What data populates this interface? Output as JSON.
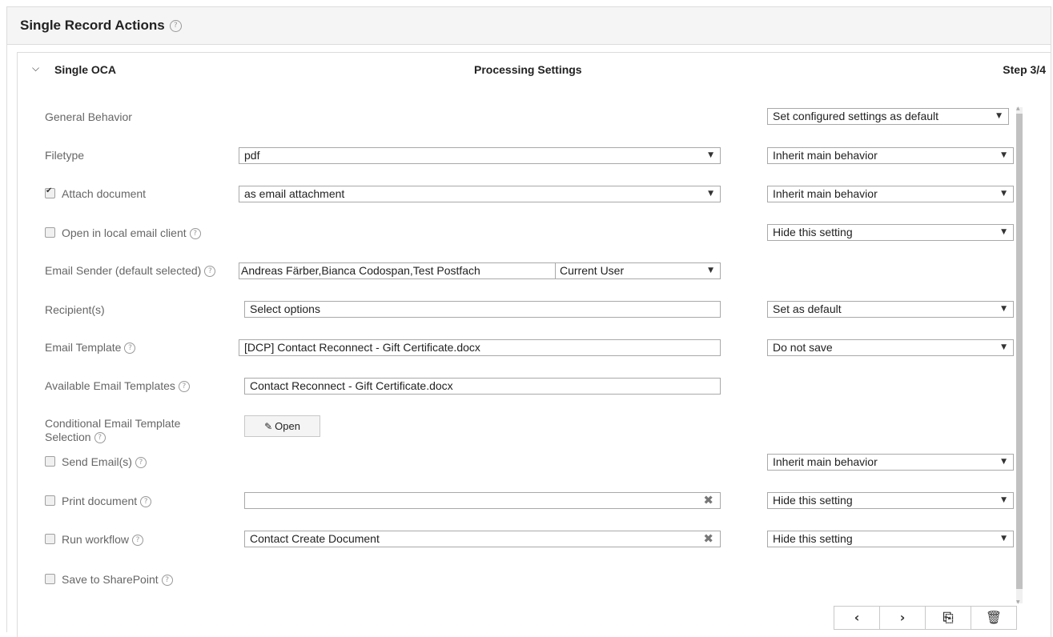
{
  "outer": {
    "title": "Single Record Actions",
    "help_glyph": "?"
  },
  "oca": {
    "name": "Single OCA",
    "section_title": "Processing Settings",
    "step": "Step 3/4"
  },
  "rows": {
    "general_behavior": {
      "label": "General Behavior",
      "behavior": "Set configured settings as default"
    },
    "filetype": {
      "label": "Filetype",
      "value": "pdf",
      "behavior": "Inherit main behavior"
    },
    "attach_document": {
      "label": "Attach document",
      "checked": true,
      "value": "as email attachment",
      "behavior": "Inherit main behavior"
    },
    "open_local_email": {
      "label": "Open in local email client",
      "checked": false,
      "behavior": "Hide this setting"
    },
    "email_sender": {
      "label": "Email Sender (default selected)",
      "value": "Andreas Färber,Bianca Codospan,Test Postfach",
      "default_sender": "Current User"
    },
    "recipients": {
      "label": "Recipient(s)",
      "placeholder": "Select options",
      "behavior": "Set as default"
    },
    "email_template": {
      "label": "Email Template",
      "value": "[DCP] Contact Reconnect - Gift Certificate.docx",
      "behavior": "Do not save"
    },
    "available_templates": {
      "label": "Available Email Templates",
      "value": "Contact Reconnect - Gift Certificate.docx"
    },
    "conditional_template": {
      "label": "Conditional Email Template Selection",
      "button": "Open"
    },
    "send_emails": {
      "label": "Send Email(s)",
      "checked": false,
      "behavior": "Inherit main behavior"
    },
    "print_document": {
      "label": "Print document",
      "checked": false,
      "value": "",
      "behavior": "Hide this setting"
    },
    "run_workflow": {
      "label": "Run workflow",
      "checked": false,
      "value": "Contact Create Document",
      "behavior": "Hide this setting"
    },
    "save_sharepoint": {
      "label": "Save to SharePoint",
      "checked": false
    }
  },
  "icons": {
    "chevron": "chevron-down-icon",
    "dropdown": "caret-down-icon",
    "clear": "clear-x-icon",
    "edit": "edit-icon",
    "prev": "chevron-left-icon",
    "next": "chevron-right-icon",
    "save": "save-icon",
    "delete": "trash-icon"
  }
}
